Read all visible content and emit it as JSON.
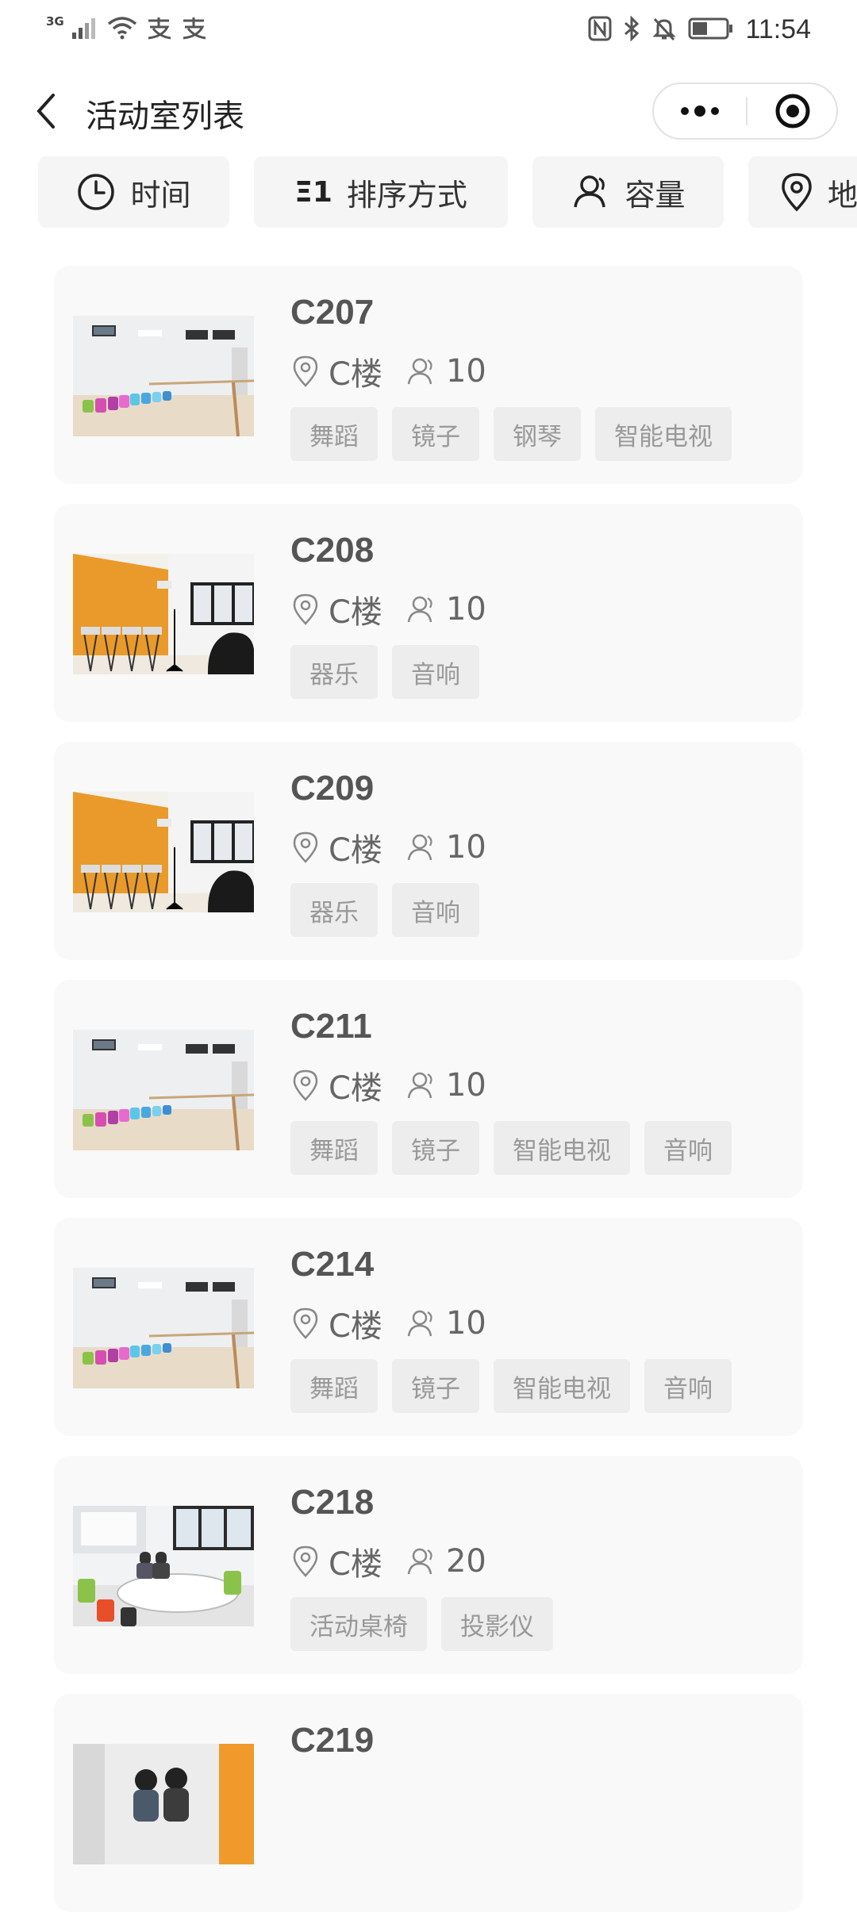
{
  "status_bar": {
    "network": "3G",
    "time": "11:54",
    "nfc": "N"
  },
  "navbar": {
    "title": "活动室列表"
  },
  "filters": [
    {
      "label": "时间",
      "icon": "clock-icon"
    },
    {
      "label": "排序方式",
      "icon": "sort-icon",
      "glyph": "Ξ1"
    },
    {
      "label": "容量",
      "icon": "people-icon"
    },
    {
      "label": "地点",
      "icon": "location-icon"
    }
  ],
  "rooms": [
    {
      "name": "C207",
      "building": "C楼",
      "capacity": "10",
      "tags": [
        "舞蹈",
        "镜子",
        "钢琴",
        "智能电视"
      ],
      "photo": "dance-studio"
    },
    {
      "name": "C208",
      "building": "C楼",
      "capacity": "10",
      "tags": [
        "器乐",
        "音响"
      ],
      "photo": "music-room"
    },
    {
      "name": "C209",
      "building": "C楼",
      "capacity": "10",
      "tags": [
        "器乐",
        "音响"
      ],
      "photo": "music-room"
    },
    {
      "name": "C211",
      "building": "C楼",
      "capacity": "10",
      "tags": [
        "舞蹈",
        "镜子",
        "智能电视",
        "音响"
      ],
      "photo": "dance-studio"
    },
    {
      "name": "C214",
      "building": "C楼",
      "capacity": "10",
      "tags": [
        "舞蹈",
        "镜子",
        "智能电视",
        "音响"
      ],
      "photo": "dance-studio"
    },
    {
      "name": "C218",
      "building": "C楼",
      "capacity": "20",
      "tags": [
        "活动桌椅",
        "投影仪"
      ],
      "photo": "meeting-room"
    },
    {
      "name": "C219",
      "building": "",
      "capacity": "",
      "tags": [],
      "photo": "group-room"
    }
  ],
  "colors": {
    "card_bg": "#f9f9f9",
    "chip_bg": "#f5f5f5",
    "tag_bg": "#ededed",
    "tag_text": "#999999"
  }
}
